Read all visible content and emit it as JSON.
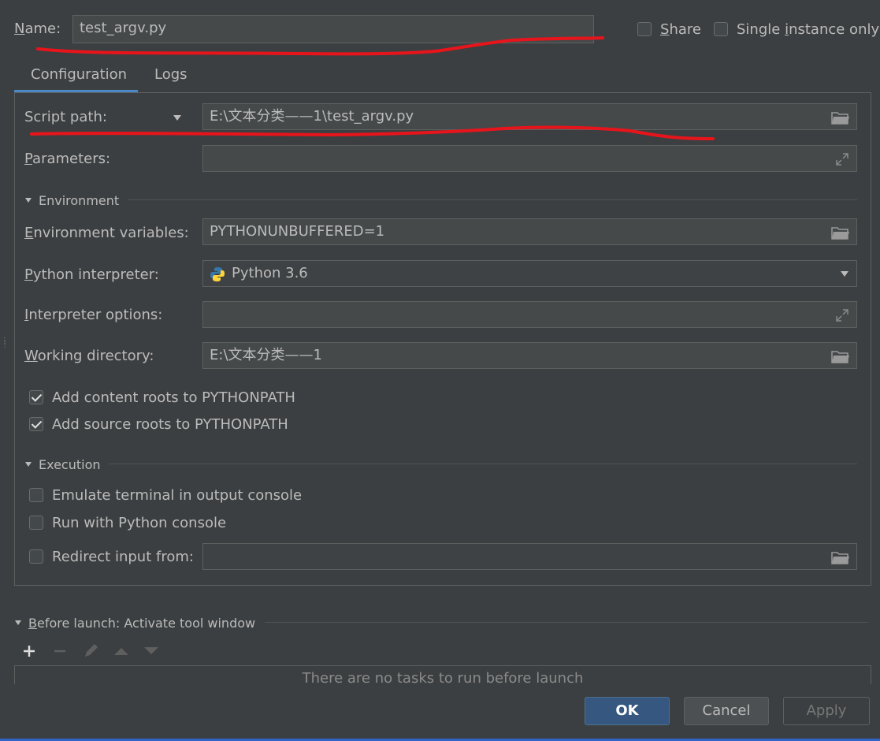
{
  "header": {
    "name_label_prefix": "N",
    "name_label_rest": "ame:",
    "name_value": "test_argv.py",
    "share_label_prefix": "S",
    "share_label_rest": "hare",
    "single_instance_label_pre": "Single ",
    "single_instance_label_u": "i",
    "single_instance_label_post": "nstance only",
    "share_checked": false,
    "single_instance_checked": false
  },
  "tabs": [
    {
      "label": "Configuration",
      "active": true
    },
    {
      "label": "Logs",
      "active": false
    }
  ],
  "config": {
    "script_path_label": "Script path:",
    "script_path_value": "E:\\文本分类——1\\test_argv.py",
    "parameters_label_u": "P",
    "parameters_label_rest": "arameters:",
    "parameters_value": "",
    "environment_section": "Environment",
    "env_vars_label_u": "E",
    "env_vars_label_rest": "nvironment variables:",
    "env_vars_value": "PYTHONUNBUFFERED=1",
    "interpreter_label_u": "P",
    "interpreter_label_rest": "ython interpreter:",
    "interpreter_value": "Python 3.6",
    "interp_options_label_u": "I",
    "interp_options_label_rest": "nterpreter options:",
    "interp_options_value": "",
    "working_dir_label_u": "W",
    "working_dir_label_rest": "orking directory:",
    "working_dir_value": "E:\\文本分类——1",
    "add_content_roots": "Add content roots to PYTHONPATH",
    "add_source_roots": "Add source roots to PYTHONPATH",
    "execution_section": "Execution",
    "emulate_terminal": "Emulate terminal in output console",
    "run_with_console": "Run with Python console",
    "redirect_input": "Redirect input from:",
    "redirect_input_value": ""
  },
  "before_launch": {
    "title_u": "B",
    "title_rest": "efore launch: Activate tool window",
    "empty_text": "There are no tasks to run before launch"
  },
  "buttons": {
    "ok": "OK",
    "cancel": "Cancel",
    "apply": "Apply"
  },
  "colors": {
    "background": "#3c3f41",
    "field": "#45494a",
    "primary_button": "#365880",
    "annotation_red": "#e8141b"
  }
}
